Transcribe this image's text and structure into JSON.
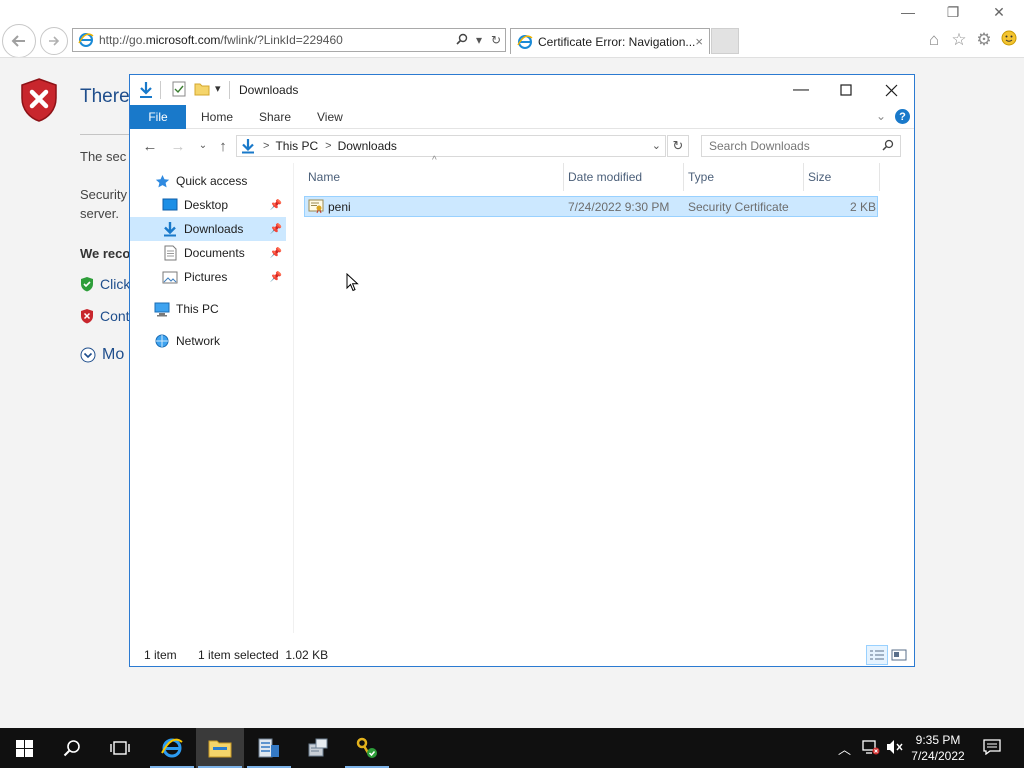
{
  "browser": {
    "url_prefix": "http://go.",
    "url_domain": "microsoft.com",
    "url_suffix": "/fwlink/?LinkId=229460",
    "tab_title": "Certificate Error: Navigation...",
    "tab_close": "×"
  },
  "cert_page": {
    "heading": "There",
    "line1": "The sec",
    "line2": "Security",
    "line3": "server.",
    "recommend": "We reco",
    "link_click": "Click",
    "link_continue": "Cont",
    "link_more": "Mo"
  },
  "explorer": {
    "title": "Downloads",
    "ribbon": {
      "file": "File",
      "home": "Home",
      "share": "Share",
      "view": "View",
      "help": "?"
    },
    "breadcrumb": [
      "This PC",
      "Downloads"
    ],
    "search_placeholder": "Search Downloads",
    "nav": {
      "quick_access": "Quick access",
      "desktop": "Desktop",
      "downloads": "Downloads",
      "documents": "Documents",
      "pictures": "Pictures",
      "this_pc": "This PC",
      "network": "Network"
    },
    "columns": {
      "name": "Name",
      "date": "Date modified",
      "type": "Type",
      "size": "Size"
    },
    "files": [
      {
        "name": "peni",
        "date": "7/24/2022 9:30 PM",
        "type": "Security Certificate",
        "size": "2 KB"
      }
    ],
    "status": {
      "count": "1 item",
      "selected": "1 item selected  1.02 KB"
    }
  },
  "taskbar": {
    "time": "9:35 PM",
    "date": "7/24/2022"
  },
  "colors": {
    "accent": "#1979ca",
    "selection": "#cce8ff",
    "link": "#1f4e8c",
    "taskbar": "#101010"
  }
}
